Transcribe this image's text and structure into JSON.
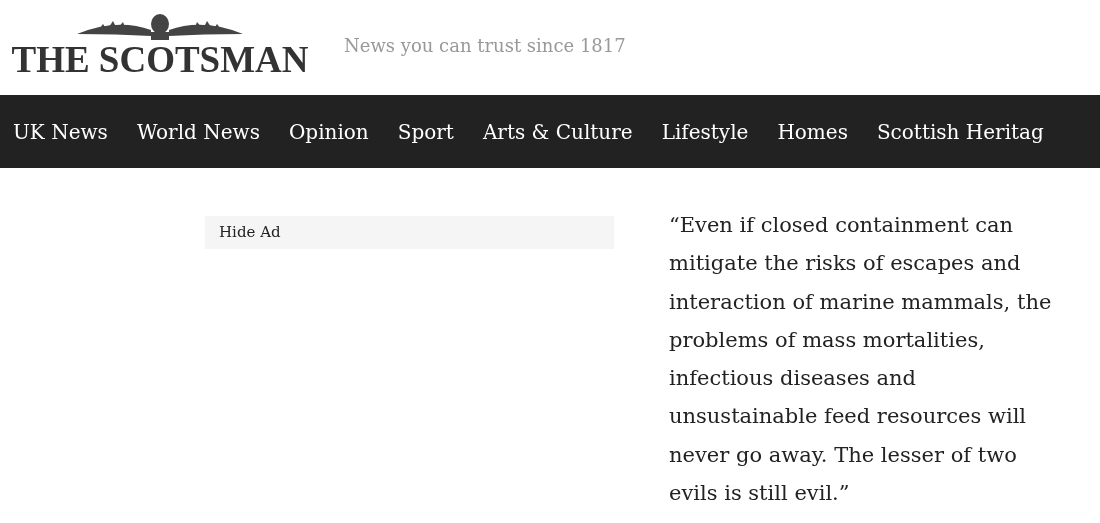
{
  "header": {
    "logo": "THE SCOTSMAN",
    "tagline": "News you can trust since 1817"
  },
  "nav": {
    "items": [
      {
        "label": "UK News"
      },
      {
        "label": "World News"
      },
      {
        "label": "Opinion"
      },
      {
        "label": "Sport"
      },
      {
        "label": "Arts & Culture"
      },
      {
        "label": "Lifestyle"
      },
      {
        "label": "Homes"
      },
      {
        "label": "Scottish Heritag"
      }
    ]
  },
  "ad": {
    "hide_label": "Hide Ad"
  },
  "quote": "“Even if closed containment can mitigate the risks of escapes and interaction of marine mammals, the problems of mass mortalities, infectious diseases and unsustainable feed resources will never go away. The lesser of two evils is still evil.”"
}
